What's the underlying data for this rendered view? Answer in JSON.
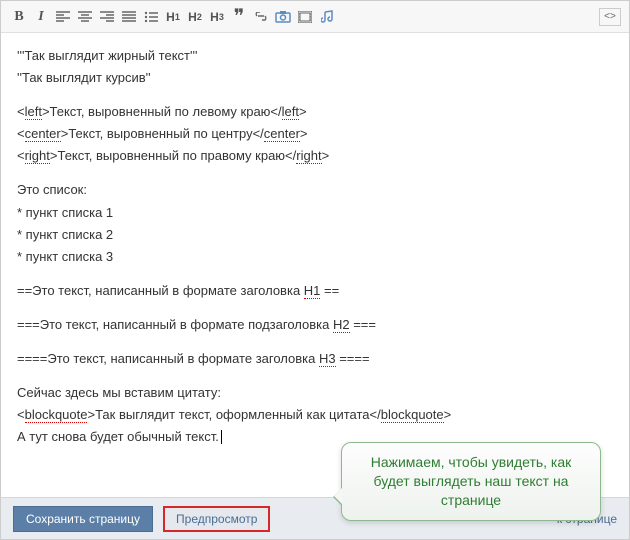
{
  "toolbar": {
    "bold": "B",
    "italic": "I",
    "h1": "H",
    "h1s": "1",
    "h2": "H",
    "h2s": "2",
    "h3": "H",
    "h3s": "3",
    "quote": "❞",
    "code": "<>"
  },
  "editor": {
    "line1_a": "'''Так выглядит жирный текст'''",
    "line2_a": "''Так выглядит курсив''",
    "line3_a": "<",
    "line3_b": "left",
    "line3_c": ">Текст, выровненный по левому краю</",
    "line3_d": "left",
    "line3_e": ">",
    "line4_a": "<",
    "line4_b": "center",
    "line4_c": ">Текст, выровненный по центру</",
    "line4_d": "center",
    "line4_e": ">",
    "line5_a": "<",
    "line5_b": "right",
    "line5_c": ">Текст, выровненный по правому краю</",
    "line5_d": "right",
    "line5_e": ">",
    "line6": "Это список:",
    "line7": "* пункт списка 1",
    "line8": "* пункт списка 2",
    "line9": "* пункт списка 3",
    "line10_a": "==Это текст, написанный в формате заголовка ",
    "line10_b": "H1",
    "line10_c": " ==",
    "line11_a": "===Это текст, написанный в формате подзаголовка ",
    "line11_b": "H2",
    "line11_c": " ===",
    "line12_a": "====Это текст, написанный в формате заголовка ",
    "line12_b": "H3",
    "line12_c": " ====",
    "line13": "Сейчас здесь мы вставим цитату:",
    "line14_a": "<",
    "line14_b": "blockquote",
    "line14_c": ">Так выглядит текст, оформленный как цитата</",
    "line14_d": "blockquote",
    "line14_e": ">",
    "line15": "А тут снова будет обычный текст."
  },
  "footer": {
    "save": "Сохранить страницу",
    "preview": "Предпросмотр",
    "back": "к странице"
  },
  "callout": {
    "text": "Нажимаем, чтобы увидеть, как будет выглядеть наш текст на странице"
  }
}
